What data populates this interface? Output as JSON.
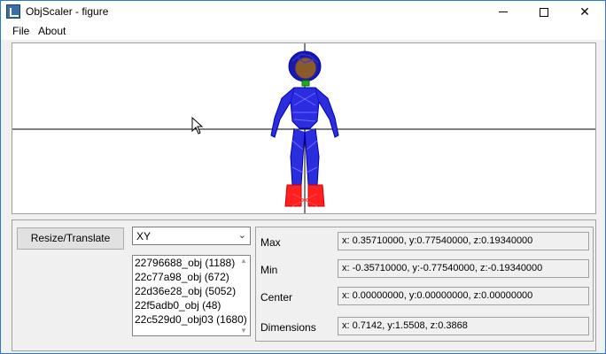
{
  "window": {
    "title": "ObjScaler - figure",
    "icon": "objscaler-app-icon",
    "controls": {
      "minimize": "minimize-icon",
      "maximize": "maximize-icon",
      "close": "✕"
    }
  },
  "menu": {
    "file": "File",
    "about": "About"
  },
  "viewport": {
    "cursor": "mouse-pointer-icon",
    "model_colors": {
      "body": "#0000cc",
      "feet": "#ff0000",
      "head": "#8b4513",
      "neck": "#00aa00",
      "axes": "#000000"
    }
  },
  "controls": {
    "resize_button": "Resize/Translate",
    "plane": {
      "selected": "XY",
      "chevron": "⌄"
    },
    "objects": [
      "22796688_obj (1188)",
      "22c77a98_obj (672)",
      "22d36e28_obj (5052)",
      "22f5adb0_obj (48)",
      "22c529d0_obj03 (1680)"
    ]
  },
  "stats": {
    "max": {
      "label": "Max",
      "value": "x: 0.35710000, y:0.77540000, z:0.19340000"
    },
    "min": {
      "label": "Min",
      "value": "x: -0.35710000, y:-0.77540000, z:-0.19340000"
    },
    "center": {
      "label": "Center",
      "value": "x: 0.00000000, y:0.00000000, z:0.00000000"
    },
    "dimensions": {
      "label": "Dimensions",
      "value": "x: 0.7142, y:1.5508, z:0.3868"
    }
  }
}
